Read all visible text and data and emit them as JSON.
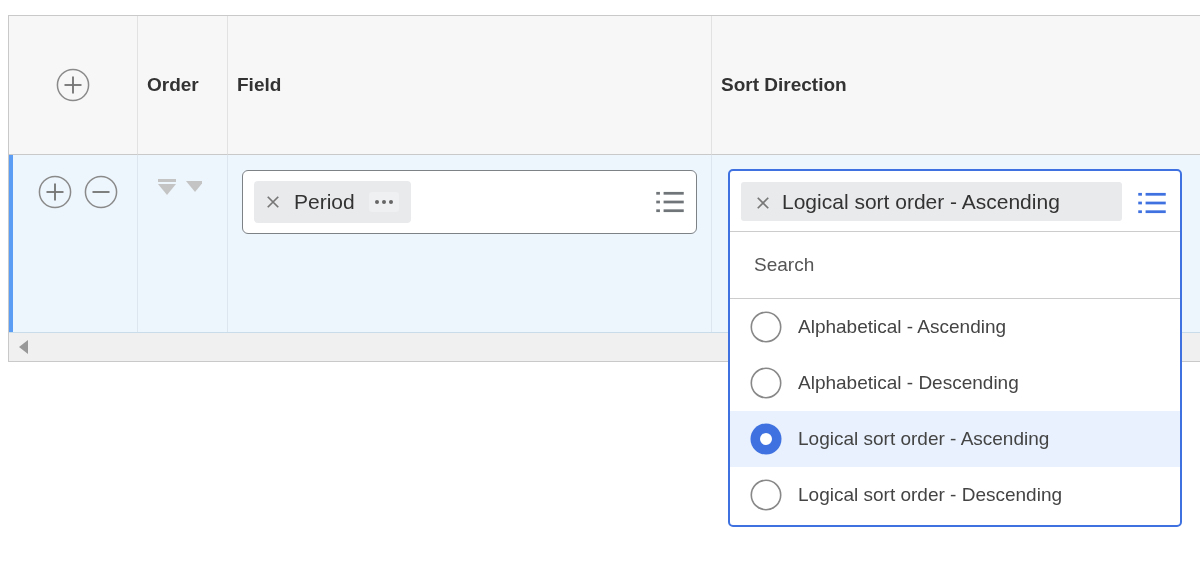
{
  "table": {
    "columns": [
      {
        "kind": "add"
      },
      {
        "kind": "text",
        "label": "Order"
      },
      {
        "kind": "text",
        "label": "Field"
      },
      {
        "kind": "text",
        "label": "Sort Direction"
      }
    ],
    "rows": [
      {
        "selected": true,
        "field": {
          "value": "Period"
        },
        "sort_direction": {
          "value": "Logical sort order - Ascending",
          "expanded": true,
          "search": {
            "placeholder": "Search"
          },
          "options": [
            {
              "label": "Alphabetical - Ascending",
              "selected": false
            },
            {
              "label": "Alphabetical - Descending",
              "selected": false
            },
            {
              "label": "Logical sort order - Ascending",
              "selected": true
            },
            {
              "label": "Logical sort order - Descending",
              "selected": false
            }
          ]
        }
      }
    ]
  }
}
